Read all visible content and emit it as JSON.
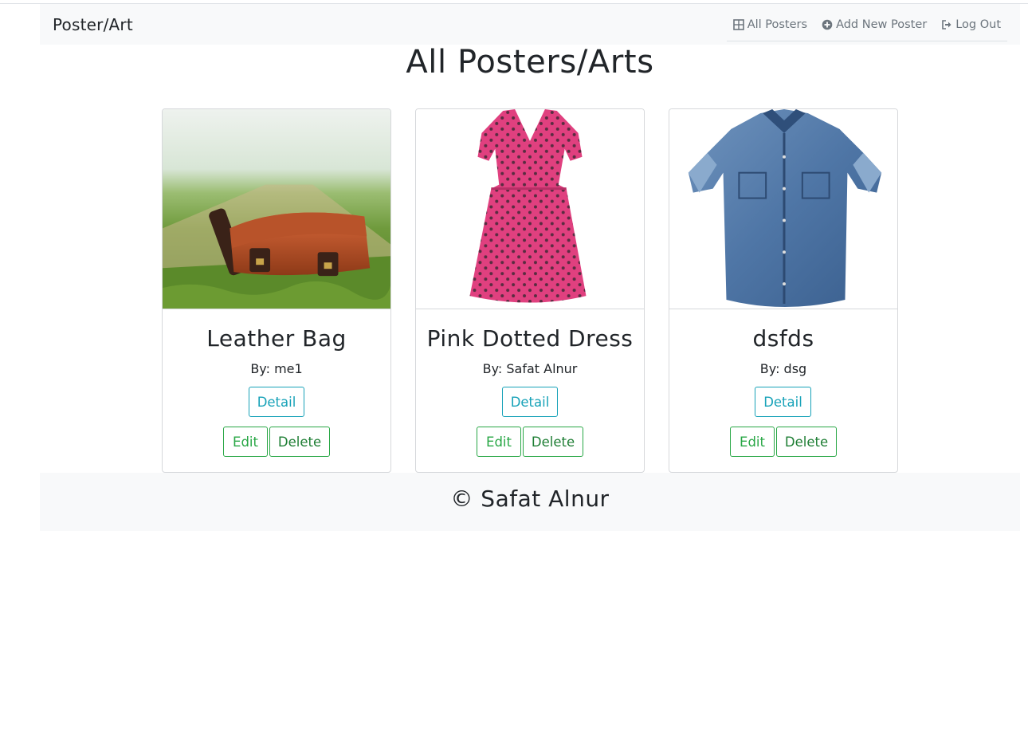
{
  "navbar": {
    "brand": "Poster/Art",
    "links": [
      {
        "label": "All Posters",
        "icon": "grid-icon"
      },
      {
        "label": "Add New Poster",
        "icon": "plus-circle-icon"
      },
      {
        "label": "Log Out",
        "icon": "sign-out-icon"
      }
    ]
  },
  "page": {
    "title": "All Posters/Arts"
  },
  "posters": [
    {
      "title": "Leather Bag",
      "author": "By: me1",
      "image": "leather-bag-photo"
    },
    {
      "title": "Pink Dotted Dress",
      "author": "By: Safat Alnur",
      "image": "pink-dress-photo"
    },
    {
      "title": "dsfds",
      "author": "By: dsg",
      "image": "denim-shirt-photo"
    }
  ],
  "buttons": {
    "detail": "Detail",
    "edit": "Edit",
    "delete": "Delete"
  },
  "footer": {
    "text": "© Safat Alnur"
  },
  "colors": {
    "info": "#17a2b8",
    "success": "#28a745",
    "navbg": "#f8f9fa"
  }
}
